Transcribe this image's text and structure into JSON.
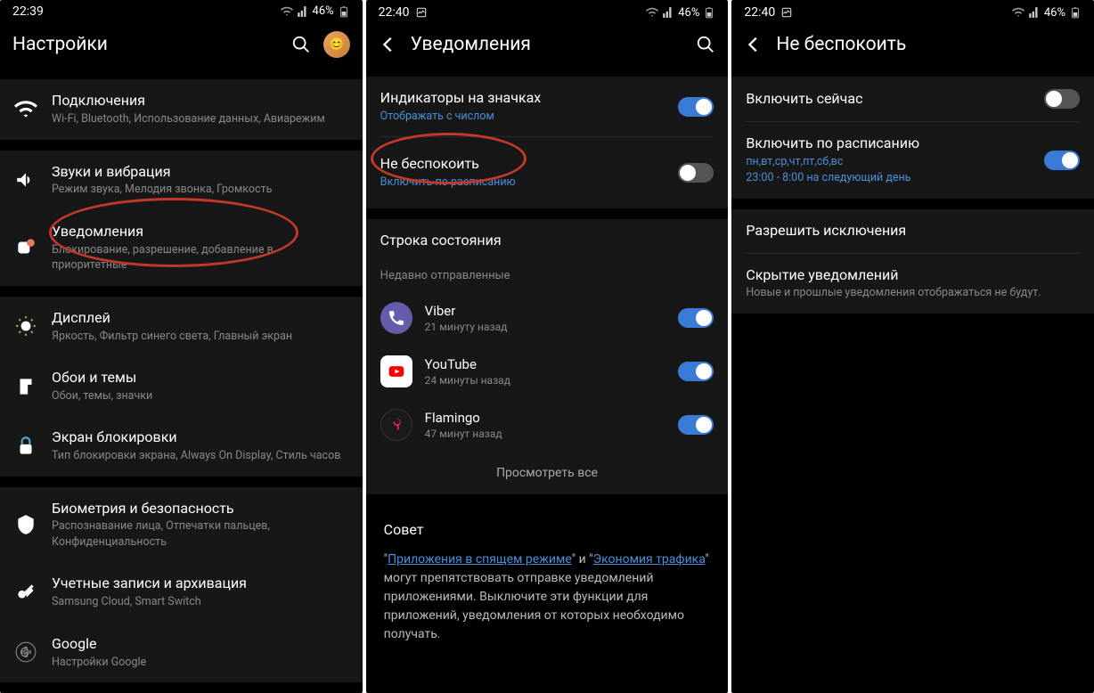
{
  "screen1": {
    "status": {
      "time": "22:39",
      "battery": "46%"
    },
    "header": {
      "title": "Настройки"
    },
    "items": [
      {
        "icon": "wifi",
        "title": "Подключения",
        "sub": "Wi-Fi, Bluetooth, Использование данных, Авиарежим"
      },
      {
        "icon": "sound",
        "title": "Звуки и вибрация",
        "sub": "Режим звука, Мелодия звонка, Громкость"
      },
      {
        "icon": "notif",
        "title": "Уведомления",
        "sub": "Блокирование, разрешение, добавление в приоритетные"
      },
      {
        "icon": "display",
        "title": "Дисплей",
        "sub": "Яркость, Фильтр синего света, Главный экран"
      },
      {
        "icon": "wallpaper",
        "title": "Обои и темы",
        "sub": "Обои, темы, значки"
      },
      {
        "icon": "lock",
        "title": "Экран блокировки",
        "sub": "Тип блокировки экрана, Always On Display, Стиль часов"
      },
      {
        "icon": "biometrics",
        "title": "Биометрия и безопасность",
        "sub": "Распознавание лица, Отпечатки пальцев, Конфиденциальность"
      },
      {
        "icon": "accounts",
        "title": "Учетные записи и архивация",
        "sub": "Samsung Cloud, Smart Switch"
      },
      {
        "icon": "google",
        "title": "Google",
        "sub": "Настройки Google"
      }
    ]
  },
  "screen2": {
    "status": {
      "time": "22:40",
      "battery": "46%"
    },
    "header": {
      "title": "Уведомления"
    },
    "items": [
      {
        "title": "Индикаторы на значках",
        "sub_blue": "Отображать с числом",
        "toggle": "on"
      },
      {
        "title": "Не беспокоить",
        "sub_blue": "Включить по расписанию",
        "toggle": "off"
      },
      {
        "title": "Строка состояния"
      }
    ],
    "recent_label": "Недавно отправленные",
    "apps": [
      {
        "name": "Viber",
        "time": "21 минуту назад",
        "color": "#665cac",
        "toggle": "on"
      },
      {
        "name": "YouTube",
        "time": "24 минуты назад",
        "color": "#ff0000",
        "toggle": "on"
      },
      {
        "name": "Flamingo",
        "time": "47 минут назад",
        "color": "#1a1a1a",
        "toggle": "on"
      }
    ],
    "see_all": "Просмотреть все",
    "tip": {
      "title": "Совет",
      "quote_open": "\"",
      "link1": "Приложения в спящем режиме",
      "middle": "\" и \"",
      "link2": "Экономия трафика",
      "body_rest": "\" могут препятствовать отправке уведомлений приложениями. Выключите эти функции для приложений, уведомления от которых необходимо получать."
    }
  },
  "screen3": {
    "status": {
      "time": "22:40",
      "battery": "46%"
    },
    "header": {
      "title": "Не беспокоить"
    },
    "items": [
      {
        "title": "Включить сейчас",
        "toggle": "off"
      },
      {
        "title": "Включить по расписанию",
        "sub_blue": "пн,вт,ср,чт,пт,сб,вс",
        "sub_blue2": "23:00 - 8:00 на следующий день",
        "toggle": "on"
      },
      {
        "title": "Разрешить исключения"
      },
      {
        "title": "Скрытие уведомлений",
        "sub": "Новые и прошлые уведомления отображаться не будут."
      }
    ]
  }
}
